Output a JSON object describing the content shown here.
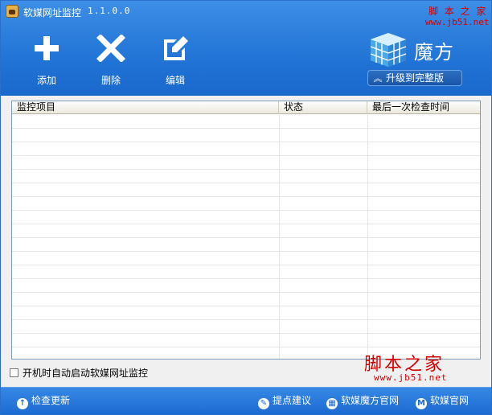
{
  "app": {
    "title": "软媒网址监控",
    "version": "1.1.0.0"
  },
  "toolbar": {
    "add_label": "添加",
    "delete_label": "删除",
    "edit_label": "编辑"
  },
  "brand": {
    "name": "魔方",
    "upgrade_label": "升级到完整版"
  },
  "watermark": {
    "top_text": "脚 本 之 家",
    "top_url": "www.jb51.net",
    "mid_text": "脚本之家",
    "mid_url": "www.jb51.net"
  },
  "list": {
    "columns": [
      "监控项目",
      "状态",
      "最后一次检查时间"
    ],
    "rows": []
  },
  "autostart": {
    "label": "开机时自动启动软媒网址监控",
    "checked": false
  },
  "footer": {
    "update_label": "检查更新",
    "suggest_label": "提点建议",
    "mofang_label": "软媒魔方官网",
    "ruanmei_label": "软媒官网"
  },
  "colors": {
    "header_blue": "#2274d6",
    "watermark_red": "#d40000"
  }
}
